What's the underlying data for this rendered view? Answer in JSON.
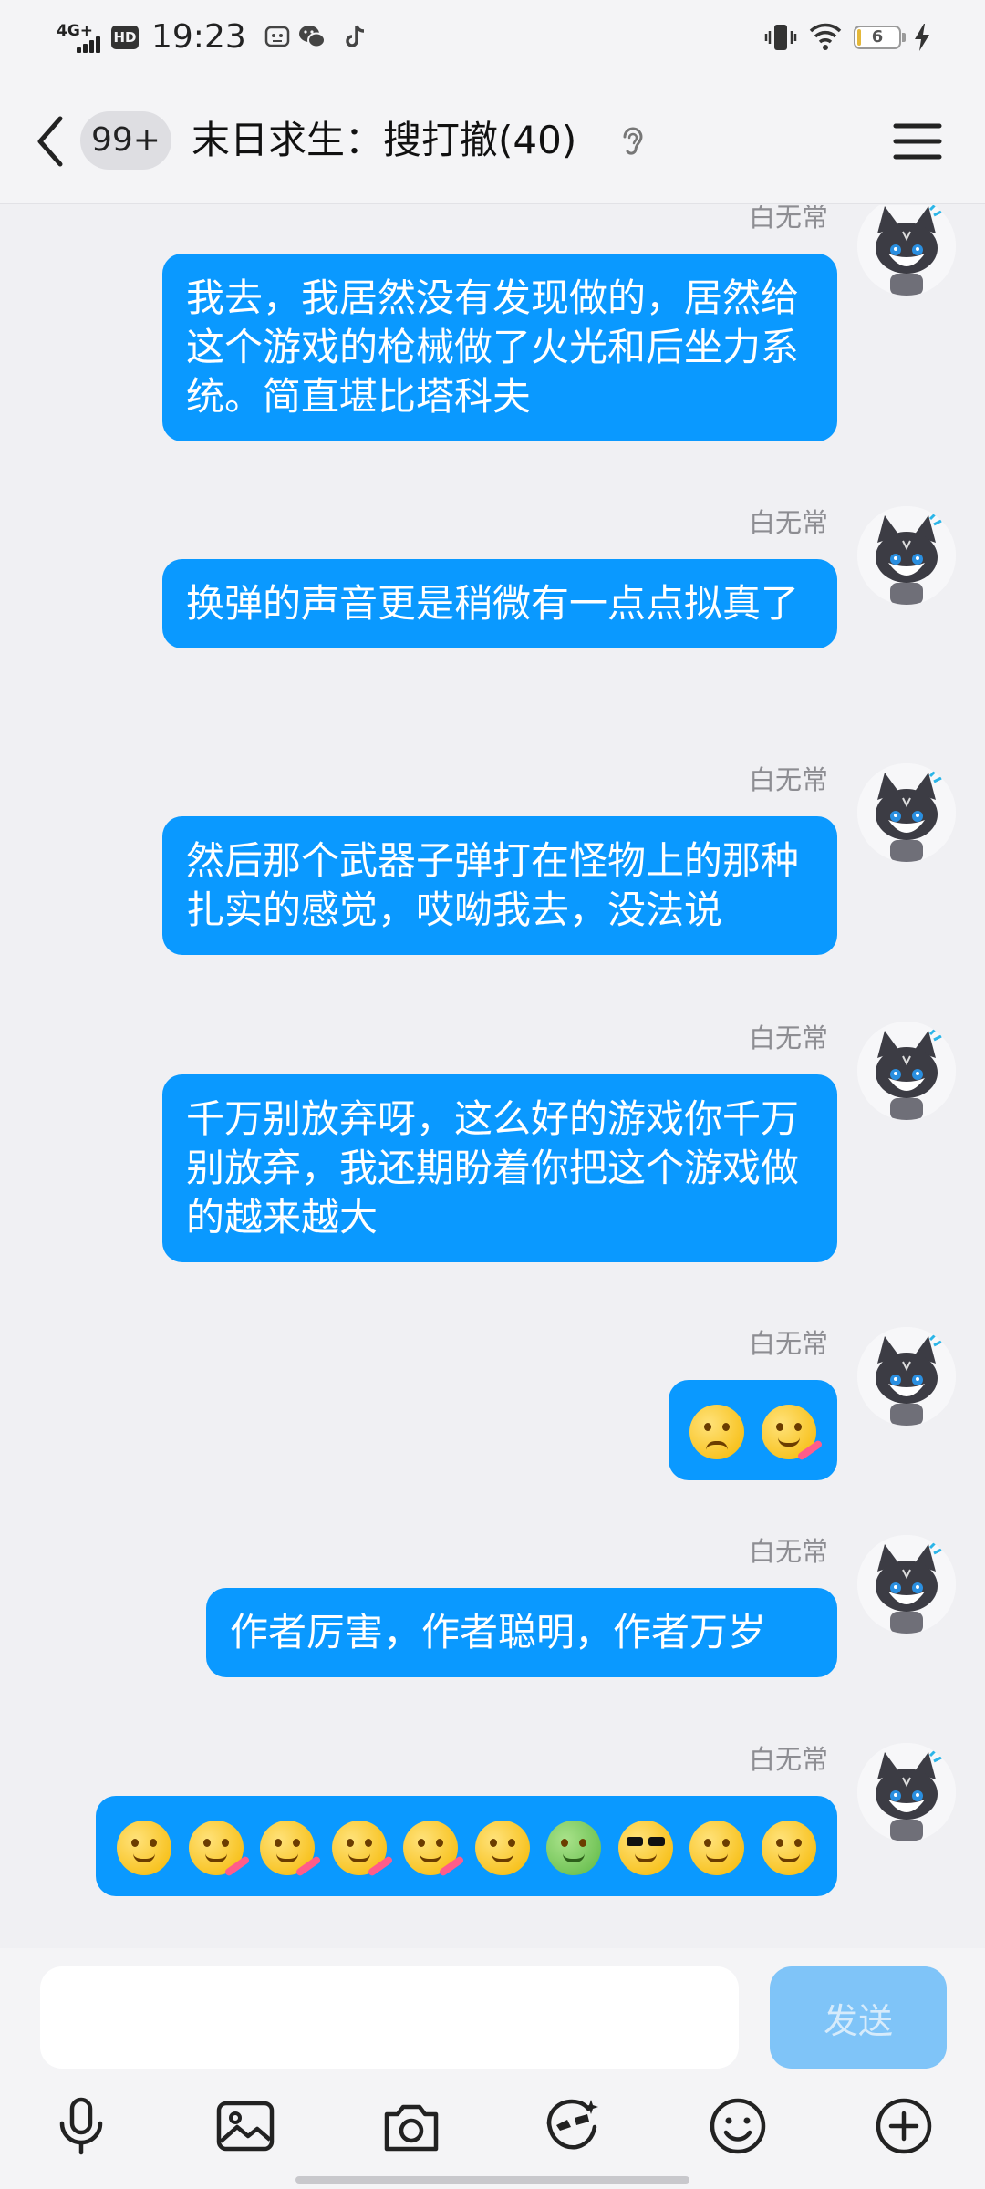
{
  "status_bar": {
    "network": "4G+",
    "hd": "HD",
    "time": "19:23",
    "battery_level": "6",
    "battery_fraction": 0.06
  },
  "header": {
    "unread_count": "99+",
    "title": "末日求生：搜打撤(40)"
  },
  "messages": [
    {
      "sender": "白无常",
      "text": "我去，我居然没有发现做的，居然给这个游戏的枪械做了火光和后坐力系统。简直堪比塔科夫"
    },
    {
      "sender": "白无常",
      "text": "换弹的声音更是稍微有一点点拟真了"
    },
    {
      "sender": "白无常",
      "text": "然后那个武器子弹打在怪物上的那种扎实的感觉，哎呦我去，没法说"
    },
    {
      "sender": "白无常",
      "text": "千万别放弃呀，这么好的游戏你千万别放弃，我还期盼着你把这个游戏做的越来越大"
    },
    {
      "sender": "白无常",
      "emojis": [
        "pouting-face",
        "party-face"
      ]
    },
    {
      "sender": "白无常",
      "text": "作者厉害，作者聪明，作者万岁"
    },
    {
      "sender": "白无常",
      "emojis": [
        "grinning-face",
        "party-face",
        "party-face",
        "party-face",
        "party-face",
        "smirk-face",
        "frog-face",
        "sunglasses-face",
        "peeking-face",
        "dizzy-face"
      ]
    }
  ],
  "input": {
    "placeholder": "",
    "send_label": "发送"
  },
  "toolbar": [
    "microphone-icon",
    "image-icon",
    "camera-icon",
    "sticker-icon",
    "emoji-icon",
    "plus-icon"
  ],
  "colors": {
    "bubble": "#0a99ff",
    "send_button": "#7fc4f8",
    "background": "#f0f0f3"
  }
}
